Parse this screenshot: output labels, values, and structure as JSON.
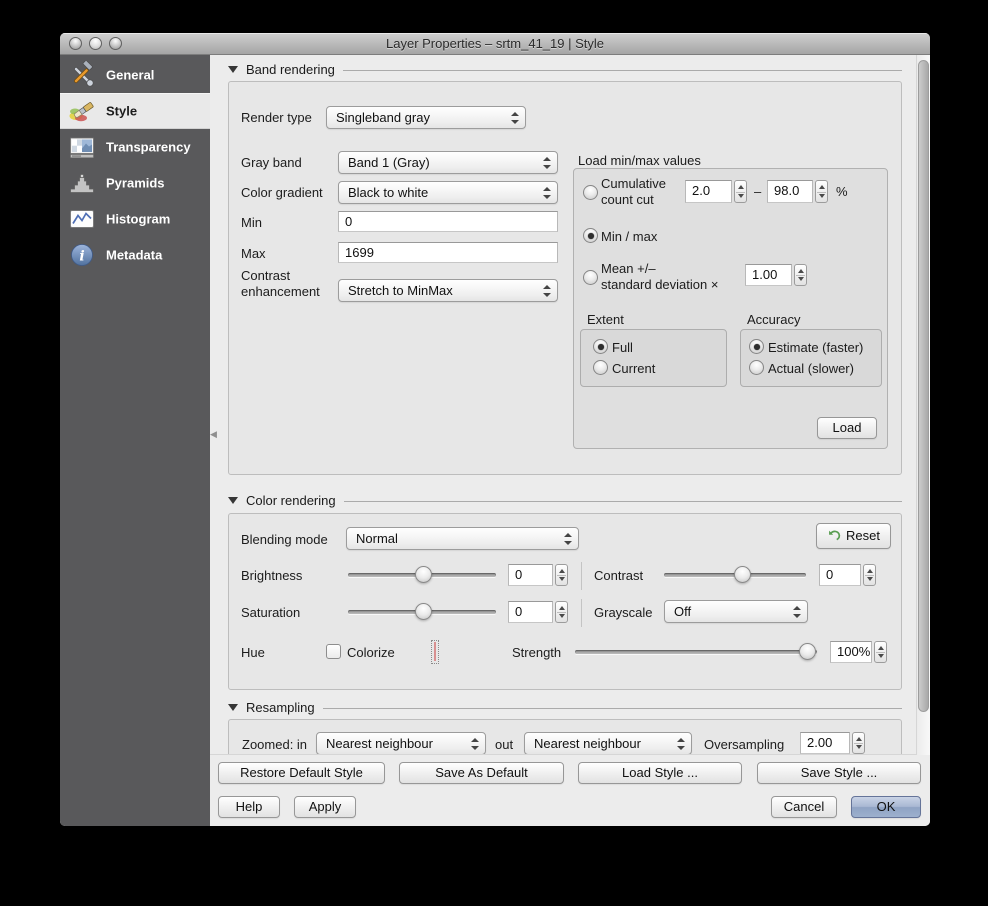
{
  "window": {
    "title": "Layer Properties – srtm_41_19 | Style"
  },
  "sidebar": {
    "items": [
      {
        "label": "General",
        "icon": "tools-icon",
        "selected": false
      },
      {
        "label": "Style",
        "icon": "paintbrush-icon",
        "selected": true
      },
      {
        "label": "Transparency",
        "icon": "transparency-icon",
        "selected": false
      },
      {
        "label": "Pyramids",
        "icon": "pyramids-icon",
        "selected": false
      },
      {
        "label": "Histogram",
        "icon": "histogram-icon",
        "selected": false
      },
      {
        "label": "Metadata",
        "icon": "metadata-icon",
        "selected": false
      }
    ]
  },
  "band_rendering": {
    "title": "Band rendering",
    "render_type_label": "Render type",
    "render_type_value": "Singleband gray",
    "gray_band_label": "Gray band",
    "gray_band_value": "Band 1 (Gray)",
    "color_gradient_label": "Color gradient",
    "color_gradient_value": "Black to white",
    "min_label": "Min",
    "min_value": "0",
    "max_label": "Max",
    "max_value": "1699",
    "contrast_label": "Contrast enhancement",
    "contrast_value": "Stretch to MinMax",
    "load_minmax": {
      "title": "Load min/max values",
      "cumulative_label": "Cumulative count cut",
      "cumulative_from": "2.0",
      "cumulative_sep": "–",
      "cumulative_to": "98.0",
      "cumulative_unit": "%",
      "minmax_label": "Min / max",
      "stddev_label_1": "Mean +/–",
      "stddev_label_2": "standard deviation ×",
      "stddev_value": "1.00",
      "selected_option": "Min / max",
      "extent": {
        "title": "Extent",
        "full": "Full",
        "current": "Current",
        "selected": "Full"
      },
      "accuracy": {
        "title": "Accuracy",
        "estimate": "Estimate (faster)",
        "actual": "Actual (slower)",
        "selected": "Estimate (faster)"
      },
      "load_button": "Load"
    }
  },
  "color_rendering": {
    "title": "Color rendering",
    "blending_label": "Blending mode",
    "blending_value": "Normal",
    "reset_button": "Reset",
    "brightness_label": "Brightness",
    "brightness_value": "0",
    "contrast_label": "Contrast",
    "contrast_value": "0",
    "saturation_label": "Saturation",
    "saturation_value": "0",
    "grayscale_label": "Grayscale",
    "grayscale_value": "Off",
    "hue_label": "Hue",
    "colorize_label": "Colorize",
    "colorize_checked": false,
    "colorize_color": "#f98383",
    "strength_label": "Strength",
    "strength_value": "100%"
  },
  "resampling": {
    "title": "Resampling",
    "zoomed_in_label": "Zoomed: in",
    "zoomed_in_value": "Nearest neighbour",
    "zoomed_out_label": "out",
    "zoomed_out_value": "Nearest neighbour",
    "oversampling_label": "Oversampling",
    "oversampling_value": "2.00"
  },
  "footer": {
    "restore_default": "Restore Default Style",
    "save_as_default": "Save As Default",
    "load_style": "Load Style ...",
    "save_style": "Save Style ...",
    "help": "Help",
    "apply": "Apply",
    "cancel": "Cancel",
    "ok": "OK"
  }
}
